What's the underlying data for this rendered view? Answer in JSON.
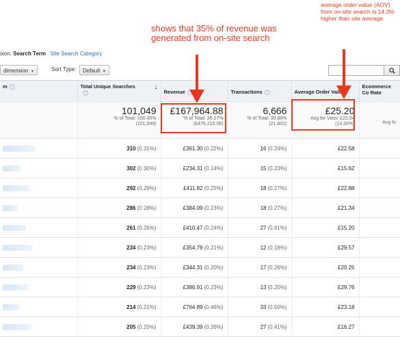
{
  "annotations": {
    "revenue_note": "shows that 35% of revenue was generated from on-site search",
    "aov_note": "average order value (AOV) from on-site search is 14.3% higher than site average",
    "color": "#e8391f"
  },
  "dimension_bar": {
    "label": "sion:",
    "primary": "Search Term",
    "alternative": "Site Search Category"
  },
  "toolbar": {
    "secondary_dimension": "dimension",
    "sort_type_label": "Sort Type:",
    "sort_type_value": "Default",
    "search_value": "",
    "search_icon": "magnifier-icon"
  },
  "table": {
    "columns": [
      {
        "label": "m"
      },
      {
        "label": "Total Unique Searches",
        "sort": "↓"
      },
      {
        "label": "Revenue"
      },
      {
        "label": "Transactions"
      },
      {
        "label": "Average Order Value"
      },
      {
        "label": "Ecommerce Co Rate"
      }
    ],
    "totals": {
      "searches": {
        "main": "101,049",
        "sub1": "% of Total: 100.00%",
        "sub2": "(101,049)"
      },
      "revenue": {
        "main": "£167,964.88",
        "sub1": "% of Total: 35.27%",
        "sub2": "(£476,215.06)"
      },
      "transactions": {
        "main": "6,666",
        "sub1": "% of Total: 30.86%",
        "sub2": "(21,602)"
      },
      "aov": {
        "main": "£25.20",
        "sub1": "Avg for View: £22.04",
        "sub2": "(14.30%)"
      },
      "conversion": {
        "main": "",
        "sub1": "Avg fo",
        "sub2": ""
      }
    },
    "rows": [
      {
        "searches": "310",
        "searches_pct": "(0.31%)",
        "revenue": "£361.30",
        "revenue_pct": "(0.22%)",
        "transactions": "16",
        "transactions_pct": "(0.24%)",
        "aov": "£22.58"
      },
      {
        "searches": "302",
        "searches_pct": "(0.30%)",
        "revenue": "£234.31",
        "revenue_pct": "(0.14%)",
        "transactions": "15",
        "transactions_pct": "(0.23%)",
        "aov": "£15.62"
      },
      {
        "searches": "292",
        "searches_pct": "(0.29%)",
        "revenue": "£411.82",
        "revenue_pct": "(0.25%)",
        "transactions": "18",
        "transactions_pct": "(0.27%)",
        "aov": "£22.88"
      },
      {
        "searches": "286",
        "searches_pct": "(0.28%)",
        "revenue": "£384.09",
        "revenue_pct": "(0.23%)",
        "transactions": "18",
        "transactions_pct": "(0.27%)",
        "aov": "£21.34"
      },
      {
        "searches": "261",
        "searches_pct": "(0.26%)",
        "revenue": "£410.47",
        "revenue_pct": "(0.24%)",
        "transactions": "27",
        "transactions_pct": "(0.41%)",
        "aov": "£15.20"
      },
      {
        "searches": "234",
        "searches_pct": "(0.23%)",
        "revenue": "£354.79",
        "revenue_pct": "(0.21%)",
        "transactions": "12",
        "transactions_pct": "(0.18%)",
        "aov": "£29.57"
      },
      {
        "searches": "234",
        "searches_pct": "(0.23%)",
        "revenue": "£344.31",
        "revenue_pct": "(0.20%)",
        "transactions": "17",
        "transactions_pct": "(0.26%)",
        "aov": "£20.25"
      },
      {
        "searches": "229",
        "searches_pct": "(0.23%)",
        "revenue": "£386.91",
        "revenue_pct": "(0.23%)",
        "transactions": "13",
        "transactions_pct": "(0.20%)",
        "aov": "£29.76"
      },
      {
        "searches": "214",
        "searches_pct": "(0.21%)",
        "revenue": "£764.89",
        "revenue_pct": "(0.46%)",
        "transactions": "33",
        "transactions_pct": "(0.50%)",
        "aov": "£23.18"
      },
      {
        "searches": "205",
        "searches_pct": "(0.20%)",
        "revenue": "£439.39",
        "revenue_pct": "(0.26%)",
        "transactions": "27",
        "transactions_pct": "(0.41%)",
        "aov": "£16.27"
      }
    ]
  }
}
